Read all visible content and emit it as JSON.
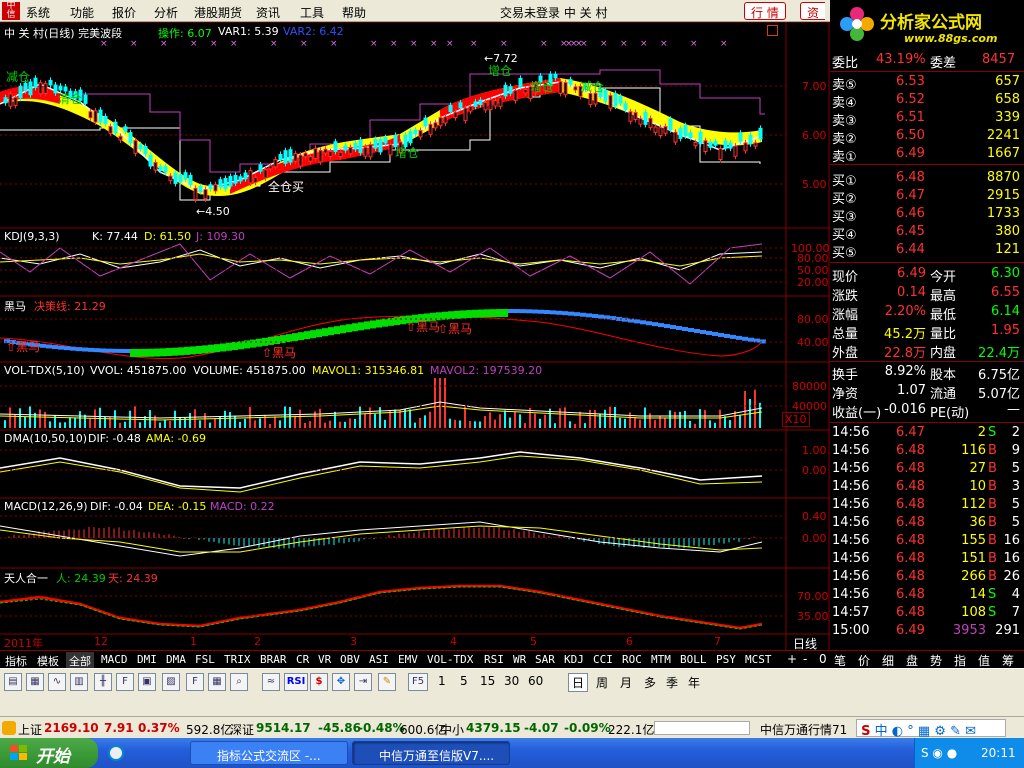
{
  "menubar": {
    "items": [
      "系统",
      "功能",
      "报价",
      "分析",
      "港股期货",
      "资讯",
      "工具",
      "帮助"
    ],
    "status": "交易未登录 中 关 村",
    "btn_quote": "行 情",
    "btn_trade": "资"
  },
  "brand": {
    "title": "分析家公式网",
    "url": "www.88gs.com"
  },
  "chart": {
    "main_title": "中 关 村(日线) 完美波段",
    "main_op": "操作: 6.07",
    "main_var1": "VAR1: 5.39",
    "main_var2": "VAR2: 6.42",
    "main_y_labels": [
      "7.00",
      "6.00",
      "5.00"
    ],
    "annot_jian": "减仓",
    "annot_qing": "清仓",
    "annot_quan": "全仓买",
    "annot_low": "4.50",
    "annot_high": "7.72",
    "annot_zeng1": "增仓",
    "annot_zeng2": "增仓",
    "annot_zeng3": "增仓",
    "annot_jian2": "减仓",
    "kdj_title": "KDJ(9,3,3)",
    "kdj_k": "K: 77.44",
    "kdj_d": "D: 61.50",
    "kdj_j": "J: 109.30",
    "kdj_y": [
      "100.00",
      "80.00",
      "50.00",
      "20.00"
    ],
    "hm_title": "黑马",
    "hm_line": "决策线: 21.29",
    "hm_label": "黑马",
    "hm_y": [
      "80.00",
      "40.00"
    ],
    "vol_title": "VOL-TDX(5,10)",
    "vol_vvol": "VVOL: 451875.00",
    "vol_volume": "VOLUME: 451875.00",
    "vol_mavol1": "MAVOL1: 315346.81",
    "vol_mavol2": "MAVOL2: 197539.20",
    "vol_y": [
      "80000",
      "40000"
    ],
    "vol_unit": "X10",
    "dma_title": "DMA(10,50,10)",
    "dma_dif": "DIF: -0.48",
    "dma_ama": "AMA: -0.69",
    "dma_y": [
      "1.00",
      "0.00"
    ],
    "macd_title": "MACD(12,26,9)",
    "macd_dif": "DIF: -0.04",
    "macd_dea": "DEA: -0.15",
    "macd_macd": "MACD: 0.22",
    "macd_y": [
      "0.40",
      "0.00"
    ],
    "trhy_title": "天人合一",
    "trhy_ren": "人: 24.39",
    "trhy_tian": "天: 24.39",
    "trhy_y": [
      "70.00",
      "35.00"
    ],
    "date_labels": [
      "2011年",
      "12",
      "1",
      "2",
      "3",
      "4",
      "5",
      "6",
      "7"
    ],
    "period_label": "日线"
  },
  "quote": {
    "weibi_label": "委比",
    "weibi_value": "43.19%",
    "weicha_label": "委差",
    "weicha_value": "8457",
    "sells": [
      {
        "label": "卖⑤",
        "price": "6.53",
        "vol": "657"
      },
      {
        "label": "卖④",
        "price": "6.52",
        "vol": "658"
      },
      {
        "label": "卖③",
        "price": "6.51",
        "vol": "339"
      },
      {
        "label": "卖②",
        "price": "6.50",
        "vol": "2241"
      },
      {
        "label": "卖①",
        "price": "6.49",
        "vol": "1667"
      }
    ],
    "buys": [
      {
        "label": "买①",
        "price": "6.48",
        "vol": "8870"
      },
      {
        "label": "买②",
        "price": "6.47",
        "vol": "2915"
      },
      {
        "label": "买③",
        "price": "6.46",
        "vol": "1733"
      },
      {
        "label": "买④",
        "price": "6.45",
        "vol": "380"
      },
      {
        "label": "买⑤",
        "price": "6.44",
        "vol": "121"
      }
    ],
    "stats": [
      {
        "l1": "现价",
        "v1": "6.49",
        "l2": "今开",
        "v2": "6.30"
      },
      {
        "l1": "涨跌",
        "v1": "0.14",
        "l2": "最高",
        "v2": "6.55"
      },
      {
        "l1": "涨幅",
        "v1": "2.20%",
        "l2": "最低",
        "v2": "6.14"
      },
      {
        "l1": "总量",
        "v1": "45.2万",
        "l2": "量比",
        "v2": "1.95"
      },
      {
        "l1": "外盘",
        "v1": "22.8万",
        "l2": "内盘",
        "v2": "22.4万"
      }
    ],
    "stats2": [
      {
        "l1": "换手",
        "v1": "8.92%",
        "l2": "股本",
        "v2": "6.75亿"
      },
      {
        "l1": "净资",
        "v1": "1.07",
        "l2": "流通",
        "v2": "5.07亿"
      },
      {
        "l1": "收益(一)",
        "v1": "-0.016",
        "l2": "PE(动)",
        "v2": "—"
      }
    ],
    "ticks": [
      {
        "t": "14:56",
        "p": "6.47",
        "v": "2",
        "d": "S",
        "n": "2"
      },
      {
        "t": "14:56",
        "p": "6.48",
        "v": "116",
        "d": "B",
        "n": "9"
      },
      {
        "t": "14:56",
        "p": "6.48",
        "v": "27",
        "d": "B",
        "n": "5"
      },
      {
        "t": "14:56",
        "p": "6.48",
        "v": "10",
        "d": "B",
        "n": "3"
      },
      {
        "t": "14:56",
        "p": "6.48",
        "v": "112",
        "d": "B",
        "n": "5"
      },
      {
        "t": "14:56",
        "p": "6.48",
        "v": "36",
        "d": "B",
        "n": "5"
      },
      {
        "t": "14:56",
        "p": "6.48",
        "v": "155",
        "d": "B",
        "n": "16"
      },
      {
        "t": "14:56",
        "p": "6.48",
        "v": "151",
        "d": "B",
        "n": "16"
      },
      {
        "t": "14:56",
        "p": "6.48",
        "v": "266",
        "d": "B",
        "n": "26"
      },
      {
        "t": "14:56",
        "p": "6.48",
        "v": "14",
        "d": "S",
        "n": "4"
      },
      {
        "t": "14:57",
        "p": "6.48",
        "v": "108",
        "d": "S",
        "n": "7"
      },
      {
        "t": "15:00",
        "p": "6.49",
        "v": "3953",
        "d": "",
        "n": "291"
      }
    ]
  },
  "tabs": {
    "left": [
      "指标",
      "模板",
      "全部",
      "MACD",
      "DMI",
      "DMA",
      "FSL",
      "TRIX",
      "BRAR",
      "CR",
      "VR",
      "OBV",
      "ASI",
      "EMV",
      "VOL-TDX",
      "RSI",
      "WR",
      "SAR",
      "KDJ",
      "CCI",
      "ROC",
      "MTM",
      "BOLL",
      "PSY",
      "MCST"
    ],
    "pm": [
      "+",
      "-",
      "0"
    ],
    "right": [
      "笔",
      "价",
      "细",
      "盘",
      "势",
      "指",
      "值",
      "筹"
    ]
  },
  "toolbar": {
    "periods": [
      "1",
      "5",
      "15",
      "30",
      "60",
      "日",
      "周",
      "月",
      "多",
      "季",
      "年"
    ],
    "f5": "F5",
    "rsi": "RSI"
  },
  "indexbar": {
    "sh_label": "上证",
    "sh_value": "2169.10",
    "sh_change": "7.91",
    "sh_pct": "0.37%",
    "sh_amount": "592.8亿",
    "sz_label": "深证",
    "sz_value": "9514.17",
    "sz_change": "-45.86",
    "sz_pct": "-0.48%",
    "sz_amount": "600.6亿",
    "zx_label": "中小",
    "zx_value": "4379.15",
    "zx_change": "-4.07",
    "zx_pct": "-0.09%",
    "zx_amount": "222.1亿",
    "app_name": "中信万通行情71"
  },
  "taskbar": {
    "start": "开始",
    "task1": "指标公式交流区 -...",
    "task2": "中信万通至信版V7....",
    "time": "20:11"
  }
}
